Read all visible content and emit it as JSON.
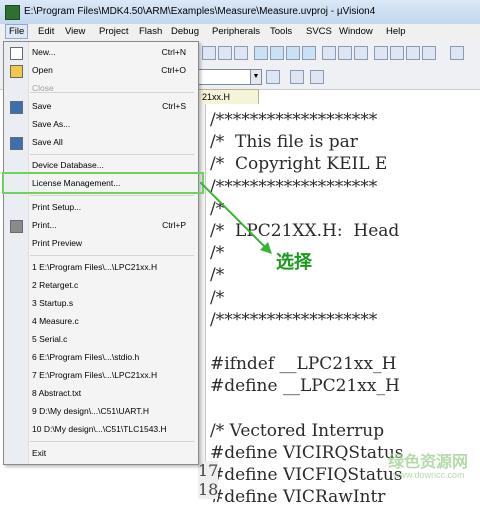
{
  "window": {
    "title": "E:\\Program Files\\MDK4.50\\ARM\\Examples\\Measure\\Measure.uvproj - µVision4"
  },
  "menubar": [
    "File",
    "Edit",
    "View",
    "Project",
    "Flash",
    "Debug",
    "Peripherals",
    "Tools",
    "SVCS",
    "Window",
    "Help"
  ],
  "editor_tab": "21xx.H",
  "code_lines": [
    "/*******************",
    "/*  This file is par",
    "/*  Copyright KEIL E",
    "/*******************",
    "/*",
    "/*  LPC21XX.H:  Head",
    "/*",
    "/*",
    "/*",
    "/*******************",
    "",
    "#ifndef __LPC21xx_H",
    "#define __LPC21xx_H",
    "",
    "/* Vectored Interrup",
    "#define VICIRQStatus",
    "#define VICFIQStatus",
    "#define VICRawIntr"
  ],
  "line_numbers": [
    "17",
    "18"
  ],
  "file_menu": [
    {
      "label": "New...",
      "shortcut": "Ctrl+N",
      "icon": "new-file-icon"
    },
    {
      "label": "Open",
      "shortcut": "Ctrl+O",
      "icon": "open-folder-icon"
    },
    {
      "label": "Close",
      "shortcut": "",
      "disabled": true
    },
    {
      "label": "Save",
      "shortcut": "Ctrl+S",
      "icon": "save-icon"
    },
    {
      "label": "Save As...",
      "shortcut": ""
    },
    {
      "label": "Save All",
      "shortcut": "",
      "icon": "save-all-icon"
    },
    {
      "label": "Device Database...",
      "shortcut": ""
    },
    {
      "label": "License Management...",
      "shortcut": ""
    },
    {
      "label": "Print Setup...",
      "shortcut": ""
    },
    {
      "label": "Print...",
      "shortcut": "Ctrl+P",
      "icon": "print-icon"
    },
    {
      "label": "Print Preview",
      "shortcut": ""
    },
    {
      "label": "1 E:\\Program Files\\...\\LPC21xx.H",
      "shortcut": ""
    },
    {
      "label": "2 Retarget.c",
      "shortcut": ""
    },
    {
      "label": "3 Startup.s",
      "shortcut": ""
    },
    {
      "label": "4 Measure.c",
      "shortcut": ""
    },
    {
      "label": "5 Serial.c",
      "shortcut": ""
    },
    {
      "label": "6 E:\\Program Files\\...\\stdio.h",
      "shortcut": ""
    },
    {
      "label": "7 E:\\Program Files\\...\\LPC21xx.H",
      "shortcut": ""
    },
    {
      "label": "8 Abstract.txt",
      "shortcut": ""
    },
    {
      "label": "9 D:\\My design\\...\\C51\\UART.H",
      "shortcut": ""
    },
    {
      "label": "10 D:\\My design\\...\\C51\\TLC1543.H",
      "shortcut": ""
    },
    {
      "label": "Exit",
      "shortcut": ""
    }
  ],
  "annotation": "选择",
  "watermark": "绿色资源网",
  "watermark_url": "www.downcc.com"
}
